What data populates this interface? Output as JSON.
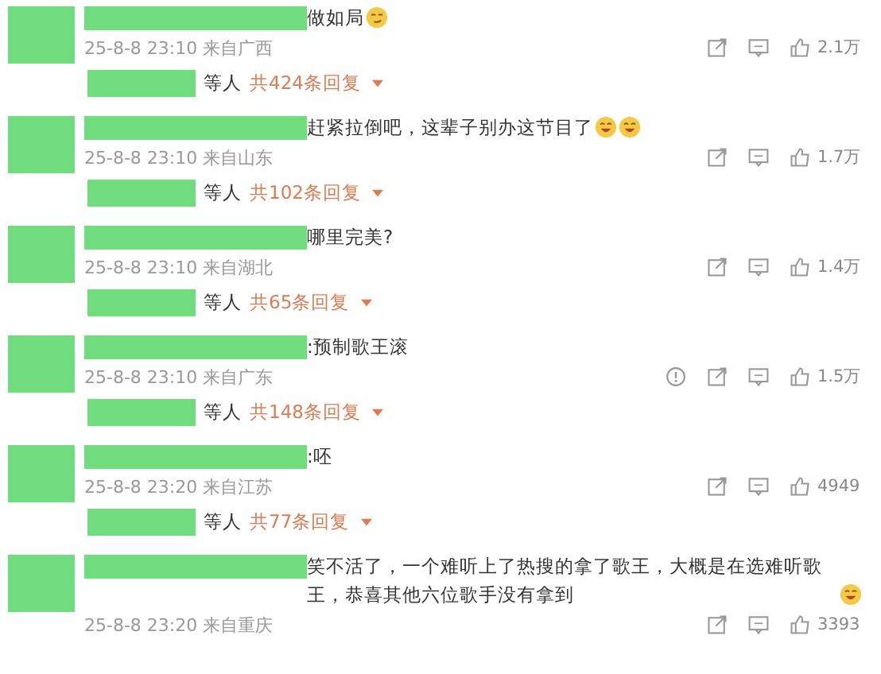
{
  "comments": [
    {
      "text": "做如局",
      "emojis": [
        {
          "kind": "smirk"
        }
      ],
      "time": "25-8-8 23:10",
      "location": "来自广西",
      "report": false,
      "likes": "2.1万",
      "reply_suffix": "等人",
      "reply_count": "共424条回复"
    },
    {
      "text": "赶紧拉倒吧，这辈子别办这节目了",
      "emojis": [
        {
          "kind": "grin"
        },
        {
          "kind": "grin"
        }
      ],
      "time": "25-8-8 23:10",
      "location": "来自山东",
      "report": false,
      "likes": "1.7万",
      "reply_suffix": "等人",
      "reply_count": "共102条回复"
    },
    {
      "text": "哪里完美?",
      "time": "25-8-8 23:10",
      "location": "来自湖北",
      "report": false,
      "likes": "1.4万",
      "reply_suffix": "等人",
      "reply_count": "共65条回复"
    },
    {
      "text": ":预制歌王滚",
      "time": "25-8-8 23:10",
      "location": "来自广东",
      "report": true,
      "likes": "1.5万",
      "reply_suffix": "等人",
      "reply_count": "共148条回复"
    },
    {
      "text": ":呸",
      "time": "25-8-8 23:20",
      "location": "来自江苏",
      "report": false,
      "likes": "4949",
      "reply_suffix": "等人",
      "reply_count": "共77条回复"
    },
    {
      "text": "笑不活了，一个难听上了热搜的拿了歌王，大概是在选难听歌王，恭喜其他六位歌手没有拿到",
      "emojis": [
        {
          "kind": "grin"
        }
      ],
      "time": "25-8-8 23:20",
      "location": "来自重庆",
      "report": false,
      "likes": "3393"
    }
  ]
}
